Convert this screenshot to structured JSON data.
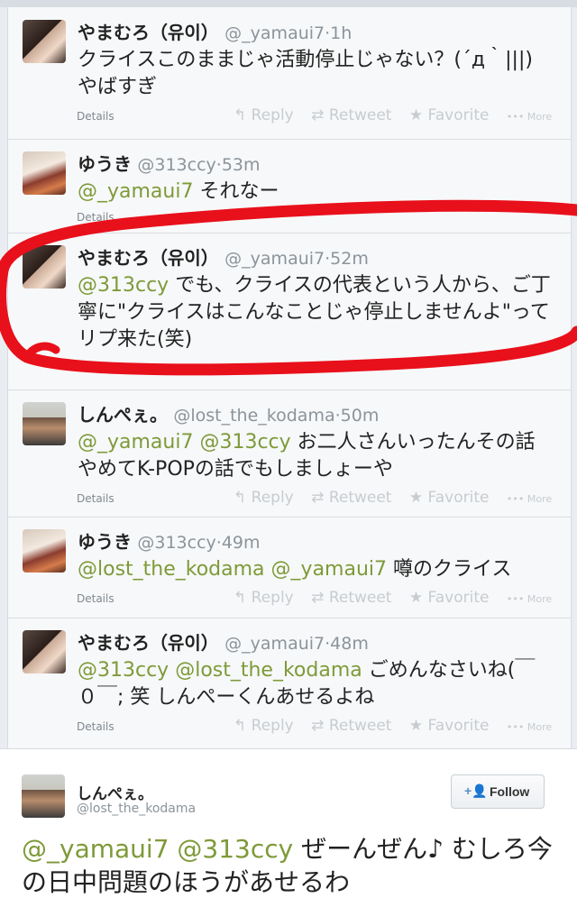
{
  "tweets": [
    {
      "name": "やまむろ（유이）",
      "handle": "@_yamaui7",
      "time": "1h",
      "mentions": [],
      "text": "クライスこのままじゃ活動停止じゃない？(´д｀|||)やばすぎ",
      "details": "Details",
      "avatar": "yamamuro-avatar"
    },
    {
      "name": "ゆうき",
      "handle": "@313ccy",
      "time": "53m",
      "mentions": [
        "@_yamaui7"
      ],
      "text": "それなー",
      "details": "Details",
      "avatar": "yuuki-avatar"
    },
    {
      "name": "やまむろ（유이）",
      "handle": "@_yamaui7",
      "time": "52m",
      "mentions": [
        "@313ccy"
      ],
      "text": "でも、クライスの代表という人から、ご丁寧に\"クライスはこんなことじゃ停止しませんよ\"ってリプ来た(笑)",
      "details": "",
      "avatar": "yamamuro-avatar"
    },
    {
      "name": "しんぺぇ。",
      "handle": "@lost_the_kodama",
      "time": "50m",
      "mentions": [
        "@_yamaui7",
        "@313ccy"
      ],
      "text": "お二人さんいったんその話やめてK-POPの話でもしましょーや",
      "details": "Details",
      "avatar": "shinpei-avatar"
    },
    {
      "name": "ゆうき",
      "handle": "@313ccy",
      "time": "49m",
      "mentions": [
        "@lost_the_kodama",
        "@_yamaui7"
      ],
      "text": "噂のクライス",
      "details": "Details",
      "avatar": "yuuki-avatar"
    },
    {
      "name": "やまむろ（유이）",
      "handle": "@_yamaui7",
      "time": "48m",
      "mentions": [
        "@313ccy",
        "@lost_the_kodama"
      ],
      "text": "ごめんなさいね(￣０￣; 笑 しんぺーくんあせるよね",
      "details": "Details",
      "avatar": "yamamuro-avatar"
    }
  ],
  "actions": {
    "reply": "Reply",
    "retweet": "Retweet",
    "favorite": "Favorite",
    "more": "More",
    "sep": "·"
  },
  "card": {
    "name": "しんぺぇ。",
    "handle": "@lost_the_kodama",
    "follow_label": "Follow",
    "mentions": [
      "@_yamaui7",
      "@313ccy"
    ],
    "text": "ぜーんぜん♪ むしろ今の日中問題のほうがあせるわ"
  },
  "colors": {
    "mention": "#7e9a39",
    "annotation": "#e8101b"
  }
}
